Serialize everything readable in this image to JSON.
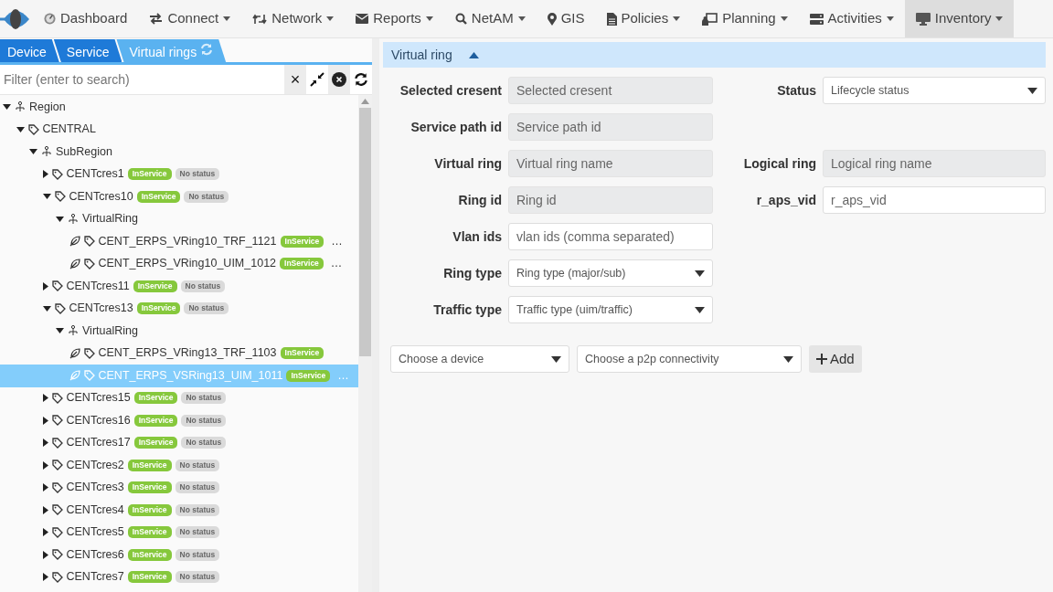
{
  "navbar": {
    "items": [
      {
        "label": "Dashboard",
        "dropdown": false,
        "selected": false
      },
      {
        "label": "Connect",
        "dropdown": true,
        "selected": false
      },
      {
        "label": "Network",
        "dropdown": true,
        "selected": false
      },
      {
        "label": "Reports",
        "dropdown": true,
        "selected": false
      },
      {
        "label": "NetAM",
        "dropdown": true,
        "selected": false
      },
      {
        "label": "GIS",
        "dropdown": false,
        "selected": false
      },
      {
        "label": "Policies",
        "dropdown": true,
        "selected": false
      },
      {
        "label": "Planning",
        "dropdown": true,
        "selected": false
      },
      {
        "label": "Activities",
        "dropdown": true,
        "selected": false
      },
      {
        "label": "Inventory",
        "dropdown": true,
        "selected": true
      }
    ]
  },
  "tabs": [
    {
      "label": "Device",
      "selected": false
    },
    {
      "label": "Service",
      "selected": false
    },
    {
      "label": "Virtual rings",
      "selected": true
    }
  ],
  "filter": {
    "placeholder": "Filter (enter to search)",
    "clear": "×"
  },
  "tree": [
    {
      "label": "Region",
      "kind": "group",
      "expanded": true,
      "selected": false,
      "children": [
        {
          "label": "CENTRAL",
          "kind": "tag",
          "expanded": true,
          "selected": false,
          "children": [
            {
              "label": "SubRegion",
              "kind": "group",
              "expanded": true,
              "selected": false,
              "children": [
                {
                  "label": "CENTcres1",
                  "kind": "tag",
                  "expanded": false,
                  "selected": false,
                  "badges": [
                    {
                      "text": "InService",
                      "kind": "ok"
                    },
                    {
                      "text": "No status",
                      "kind": "none"
                    }
                  ]
                },
                {
                  "label": "CENTcres10",
                  "kind": "tag",
                  "expanded": true,
                  "selected": false,
                  "badges": [
                    {
                      "text": "InService",
                      "kind": "ok"
                    },
                    {
                      "text": "No status",
                      "kind": "none"
                    }
                  ],
                  "children": [
                    {
                      "label": "VirtualRing",
                      "kind": "group",
                      "expanded": true,
                      "selected": false,
                      "children": [
                        {
                          "label": "CENT_ERPS_VRing10_TRF_1121",
                          "kind": "ring",
                          "selected": false,
                          "badges": [
                            {
                              "text": "InService",
                              "kind": "ok"
                            }
                          ],
                          "more": "…"
                        },
                        {
                          "label": "CENT_ERPS_VRing10_UIM_1012",
                          "kind": "ring",
                          "selected": false,
                          "badges": [
                            {
                              "text": "InService",
                              "kind": "ok"
                            }
                          ],
                          "more": "…"
                        }
                      ]
                    }
                  ]
                },
                {
                  "label": "CENTcres11",
                  "kind": "tag",
                  "expanded": false,
                  "selected": false,
                  "badges": [
                    {
                      "text": "InService",
                      "kind": "ok"
                    },
                    {
                      "text": "No status",
                      "kind": "none"
                    }
                  ]
                },
                {
                  "label": "CENTcres13",
                  "kind": "tag",
                  "expanded": true,
                  "selected": false,
                  "badges": [
                    {
                      "text": "InService",
                      "kind": "ok"
                    },
                    {
                      "text": "No status",
                      "kind": "none"
                    }
                  ],
                  "children": [
                    {
                      "label": "VirtualRing",
                      "kind": "group",
                      "expanded": true,
                      "selected": false,
                      "children": [
                        {
                          "label": "CENT_ERPS_VRing13_TRF_1103",
                          "kind": "ring",
                          "selected": false,
                          "badges": [
                            {
                              "text": "InService",
                              "kind": "ok"
                            }
                          ]
                        },
                        {
                          "label": "CENT_ERPS_VSRing13_UIM_1011",
                          "kind": "ring",
                          "selected": true,
                          "badges": [
                            {
                              "text": "InService",
                              "kind": "ok"
                            }
                          ],
                          "more": "…"
                        }
                      ]
                    }
                  ]
                },
                {
                  "label": "CENTcres15",
                  "kind": "tag",
                  "expanded": false,
                  "selected": false,
                  "badges": [
                    {
                      "text": "InService",
                      "kind": "ok"
                    },
                    {
                      "text": "No status",
                      "kind": "none"
                    }
                  ]
                },
                {
                  "label": "CENTcres16",
                  "kind": "tag",
                  "expanded": false,
                  "selected": false,
                  "badges": [
                    {
                      "text": "InService",
                      "kind": "ok"
                    },
                    {
                      "text": "No status",
                      "kind": "none"
                    }
                  ]
                },
                {
                  "label": "CENTcres17",
                  "kind": "tag",
                  "expanded": false,
                  "selected": false,
                  "badges": [
                    {
                      "text": "InService",
                      "kind": "ok"
                    },
                    {
                      "text": "No status",
                      "kind": "none"
                    }
                  ]
                },
                {
                  "label": "CENTcres2",
                  "kind": "tag",
                  "expanded": false,
                  "selected": false,
                  "badges": [
                    {
                      "text": "InService",
                      "kind": "ok"
                    },
                    {
                      "text": "No status",
                      "kind": "none"
                    }
                  ]
                },
                {
                  "label": "CENTcres3",
                  "kind": "tag",
                  "expanded": false,
                  "selected": false,
                  "badges": [
                    {
                      "text": "InService",
                      "kind": "ok"
                    },
                    {
                      "text": "No status",
                      "kind": "none"
                    }
                  ]
                },
                {
                  "label": "CENTcres4",
                  "kind": "tag",
                  "expanded": false,
                  "selected": false,
                  "badges": [
                    {
                      "text": "InService",
                      "kind": "ok"
                    },
                    {
                      "text": "No status",
                      "kind": "none"
                    }
                  ]
                },
                {
                  "label": "CENTcres5",
                  "kind": "tag",
                  "expanded": false,
                  "selected": false,
                  "badges": [
                    {
                      "text": "InService",
                      "kind": "ok"
                    },
                    {
                      "text": "No status",
                      "kind": "none"
                    }
                  ]
                },
                {
                  "label": "CENTcres6",
                  "kind": "tag",
                  "expanded": false,
                  "selected": false,
                  "badges": [
                    {
                      "text": "InService",
                      "kind": "ok"
                    },
                    {
                      "text": "No status",
                      "kind": "none"
                    }
                  ]
                },
                {
                  "label": "CENTcres7",
                  "kind": "tag",
                  "expanded": false,
                  "selected": false,
                  "badges": [
                    {
                      "text": "InService",
                      "kind": "ok"
                    },
                    {
                      "text": "No status",
                      "kind": "none"
                    }
                  ]
                }
              ]
            }
          ]
        }
      ]
    }
  ],
  "panel": {
    "title": "Virtual ring",
    "expanded": true,
    "rows": [
      [
        {
          "label": "Selected cresent",
          "placeholder": "Selected cresent",
          "kind": "input",
          "readonly": true
        },
        {
          "label": "Status",
          "placeholder": "Lifecycle status",
          "kind": "select",
          "readonly": false
        }
      ],
      [
        {
          "label": "Service path id",
          "placeholder": "Service path id",
          "kind": "input",
          "readonly": true
        }
      ],
      [
        {
          "label": "Virtual ring",
          "placeholder": "Virtual ring name",
          "kind": "input",
          "readonly": true
        },
        {
          "label": "Logical ring",
          "placeholder": "Logical ring name",
          "kind": "input",
          "readonly": true
        }
      ],
      [
        {
          "label": "Ring id",
          "placeholder": "Ring id",
          "kind": "input",
          "readonly": true
        },
        {
          "label": "r_aps_vid",
          "placeholder": "r_aps_vid",
          "kind": "input",
          "readonly": false
        }
      ],
      [
        {
          "label": "Vlan ids",
          "placeholder": "vlan ids (comma separated)",
          "kind": "input",
          "readonly": false
        }
      ],
      [
        {
          "label": "Ring type",
          "placeholder": "Ring type (major/sub)",
          "kind": "select",
          "readonly": false
        }
      ],
      [
        {
          "label": "Traffic type",
          "placeholder": "Traffic type (uim/traffic)",
          "kind": "select",
          "readonly": false
        }
      ]
    ],
    "device_select": {
      "placeholder": "Choose a device"
    },
    "p2p_select": {
      "placeholder": "Choose a p2p connectivity"
    },
    "add_button": {
      "label": "Add"
    }
  }
}
